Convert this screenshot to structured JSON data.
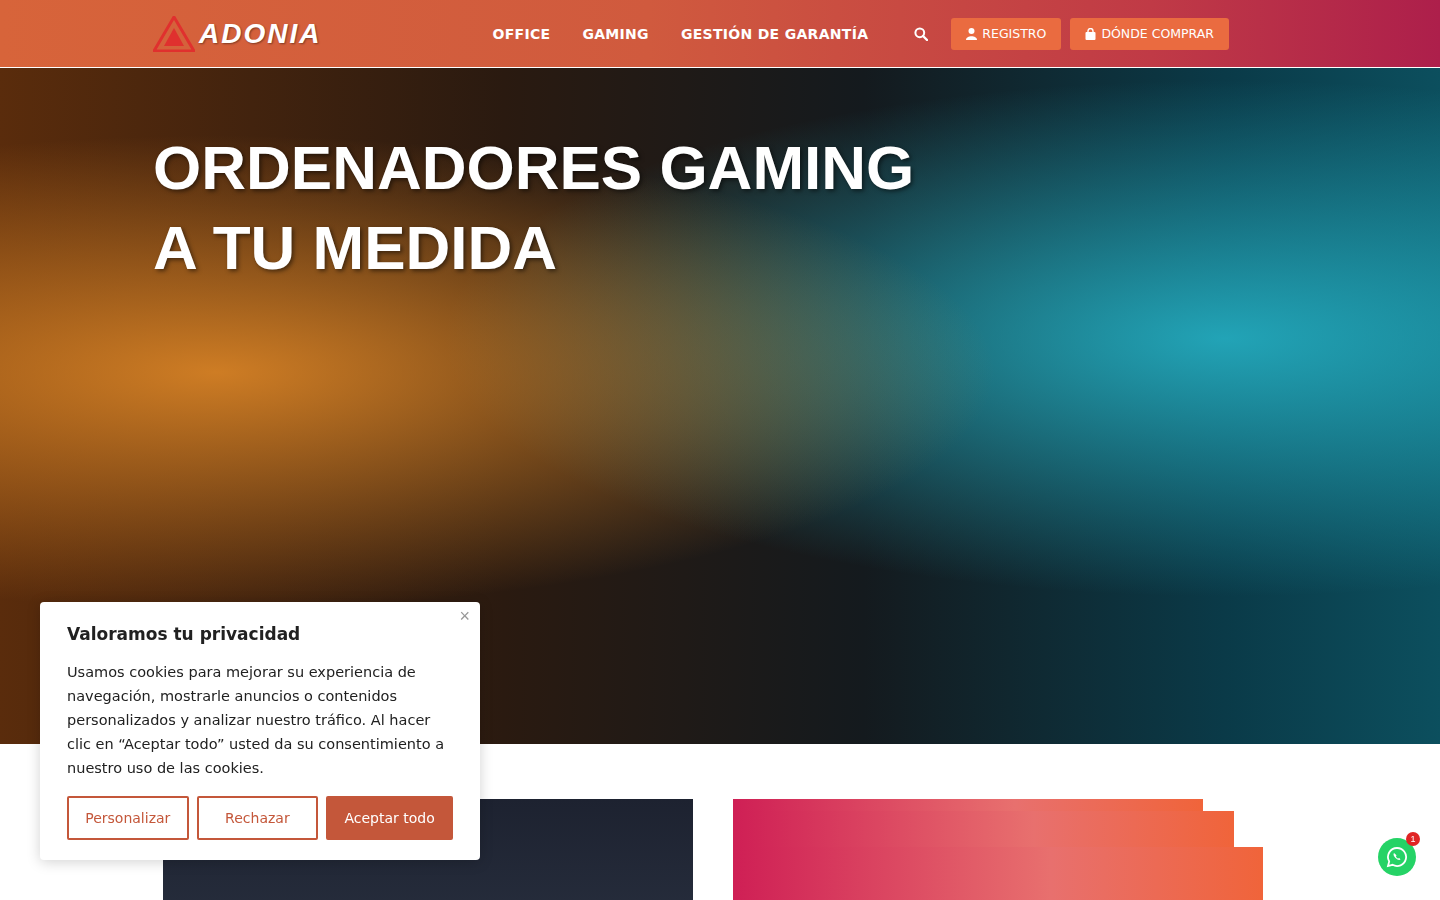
{
  "header": {
    "logo": "ADONIA",
    "nav": [
      {
        "label": "OFFICE"
      },
      {
        "label": "GAMING"
      },
      {
        "label": "GESTIÓN DE GARANTÍA"
      }
    ],
    "buttons": [
      {
        "label": "REGISTRO",
        "kind": "user"
      },
      {
        "label": "DÓNDE COMPRAR",
        "kind": "bag"
      }
    ]
  },
  "hero": {
    "title_lines": [
      "ORDENADORES GAMING",
      "A TU MEDIDA"
    ]
  },
  "cookie_banner": {
    "title": "Valoramos tu privacidad",
    "body": "Usamos cookies para mejorar su experiencia de navegación, mostrarle anuncios o contenidos personalizados y analizar nuestro tráfico. Al hacer clic en “Aceptar todo” usted da su consentimiento a nuestro uso de las cookies.",
    "close": "×",
    "buttons": [
      {
        "label": "Personalizar",
        "kind": "outline"
      },
      {
        "label": "Rechazar",
        "kind": "outline"
      },
      {
        "label": "Aceptar todo",
        "kind": "filled"
      }
    ]
  },
  "whatsapp": {
    "badge": "1"
  }
}
